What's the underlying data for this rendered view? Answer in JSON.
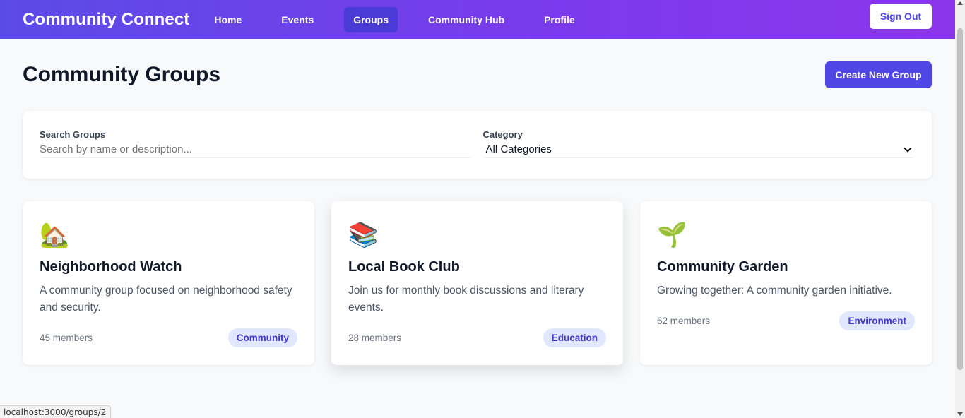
{
  "nav": {
    "brand": "Community Connect",
    "links": [
      {
        "label": "Home",
        "active": false
      },
      {
        "label": "Events",
        "active": false
      },
      {
        "label": "Groups",
        "active": true
      },
      {
        "label": "Community Hub",
        "active": false
      },
      {
        "label": "Profile",
        "active": false
      }
    ],
    "sign_out": "Sign Out"
  },
  "page": {
    "title": "Community Groups",
    "create_button": "Create New Group"
  },
  "filters": {
    "search_label": "Search Groups",
    "search_placeholder": "Search by name or description...",
    "search_value": "",
    "category_label": "Category",
    "category_value": "All Categories"
  },
  "groups": [
    {
      "icon": "house-garden-icon",
      "emoji": "🏡",
      "name": "Neighborhood Watch",
      "description": "A community group focused on neighborhood safety and security.",
      "members": "45 members",
      "category": "Community"
    },
    {
      "icon": "books-icon",
      "emoji": "📚",
      "name": "Local Book Club",
      "description": "Join us for monthly book discussions and literary events.",
      "members": "28 members",
      "category": "Education"
    },
    {
      "icon": "seedling-icon",
      "emoji": "🌱",
      "name": "Community Garden",
      "description": "Growing together: A community garden initiative.",
      "members": "62 members",
      "category": "Environment"
    }
  ],
  "status_bar": {
    "url": "localhost:3000/groups/2"
  },
  "colors": {
    "primary": "#4f46e5",
    "tag_bg": "#e0e7ff",
    "tag_text": "#4338ca",
    "nav_gradient_start": "#5b4be6",
    "nav_gradient_end": "#8b35ea"
  }
}
